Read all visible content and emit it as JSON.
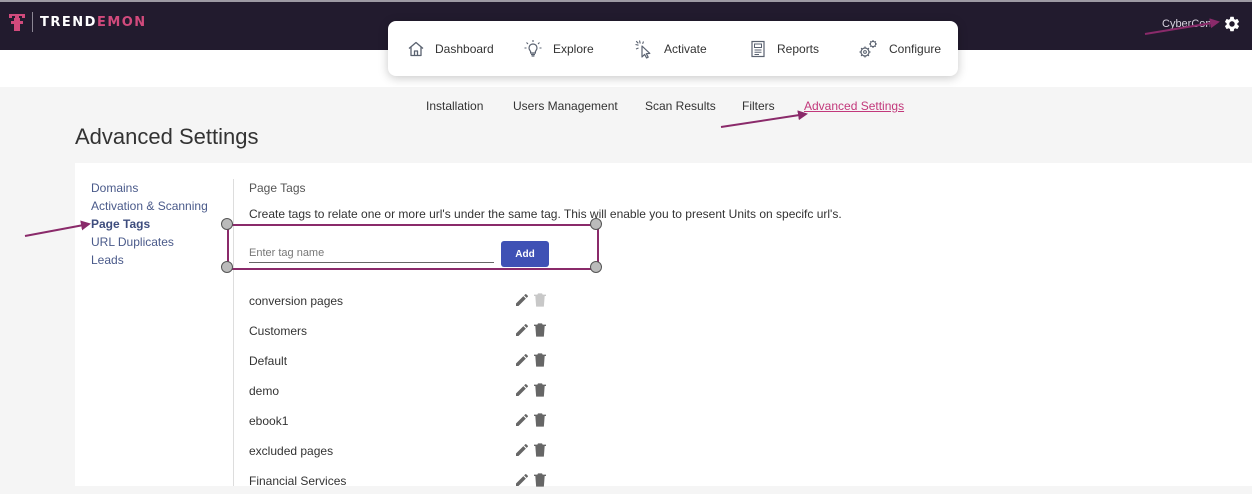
{
  "brand": {
    "prefix": "TREND",
    "suffix": "EMON"
  },
  "user": {
    "name": "CyberCon"
  },
  "nav": [
    {
      "label": "Dashboard",
      "icon": "home-icon"
    },
    {
      "label": "Explore",
      "icon": "lightbulb-icon"
    },
    {
      "label": "Activate",
      "icon": "click-cursor-icon"
    },
    {
      "label": "Reports",
      "icon": "report-doc-icon"
    },
    {
      "label": "Configure",
      "icon": "gears-icon"
    }
  ],
  "subnav": [
    {
      "label": "Installation"
    },
    {
      "label": "Users Management"
    },
    {
      "label": "Scan Results"
    },
    {
      "label": "Filters"
    },
    {
      "label": "Advanced Settings",
      "active": true
    }
  ],
  "page": {
    "title": "Advanced Settings"
  },
  "sidebar": [
    {
      "label": "Domains"
    },
    {
      "label": "Activation & Scanning"
    },
    {
      "label": "Page Tags",
      "active": true
    },
    {
      "label": "URL Duplicates"
    },
    {
      "label": "Leads"
    }
  ],
  "pageTags": {
    "title": "Page Tags",
    "description": "Create tags to relate one or more url's under the same tag. This will enable you to present Units on specifc url's.",
    "input": {
      "placeholder": "Enter tag name",
      "value": ""
    },
    "add_label": "Add",
    "tags": [
      {
        "name": "conversion pages",
        "delete_enabled": false
      },
      {
        "name": "Customers",
        "delete_enabled": true
      },
      {
        "name": "Default",
        "delete_enabled": true
      },
      {
        "name": "demo",
        "delete_enabled": true
      },
      {
        "name": "ebook1",
        "delete_enabled": true
      },
      {
        "name": "excluded pages",
        "delete_enabled": true
      },
      {
        "name": "Financial Services",
        "delete_enabled": true
      }
    ]
  },
  "colors": {
    "topbar": "#221b2e",
    "brand_accent": "#d14a7c",
    "active_link": "#c2387b",
    "sidebar_link": "#4a5a8a",
    "add_button": "#3f51b5",
    "annotation": "#8a2a6a"
  }
}
